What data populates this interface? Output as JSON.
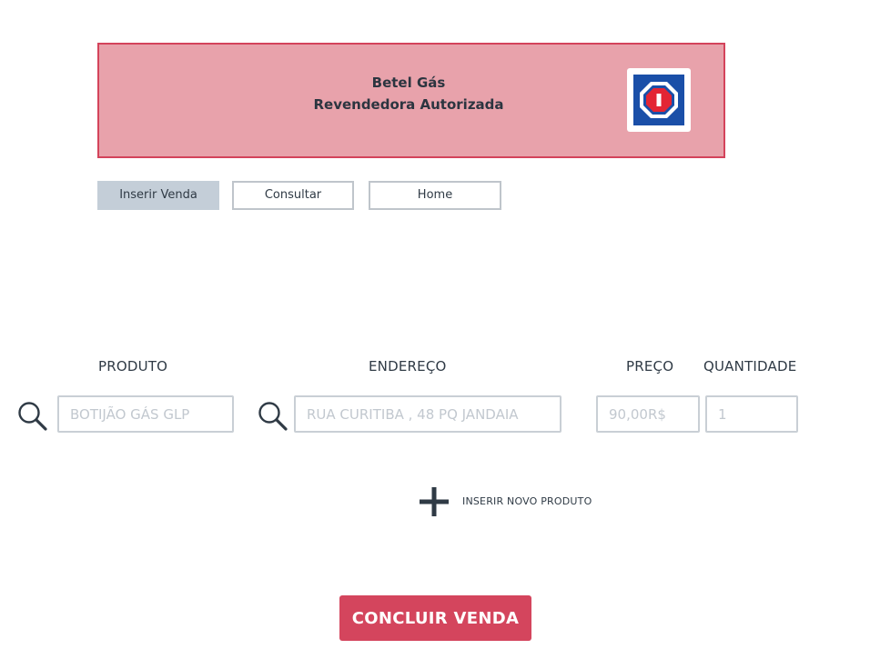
{
  "header": {
    "title_line1": "Betel Gás",
    "title_line2": "Revendedora Autorizada",
    "logo_icon": "gas-brand-logo-icon",
    "background_color": "#e8a2ab",
    "border_color": "#d4435b"
  },
  "nav": {
    "items": [
      {
        "label": "Inserir Venda",
        "active": true
      },
      {
        "label": "Consultar",
        "active": false
      },
      {
        "label": "Home",
        "active": false
      }
    ]
  },
  "form": {
    "columns": {
      "produto": "PRODUTO",
      "endereco": "ENDEREÇO",
      "preco": "PREÇO",
      "quantidade": "QUANTIDADE"
    },
    "placeholders": {
      "produto": "BOTIJÃO GÁS GLP",
      "endereco": "RUA CURITIBA , 48 PQ JANDAIA",
      "preco": "90,00R$",
      "quantidade": "1"
    },
    "icons": {
      "search": "search-icon",
      "add": "plus-icon"
    },
    "add_product_label": "INSERIR NOVO PRODUTO"
  },
  "actions": {
    "submit_label": "CONCLUIR VENDA",
    "accent_color": "#d4455d"
  }
}
